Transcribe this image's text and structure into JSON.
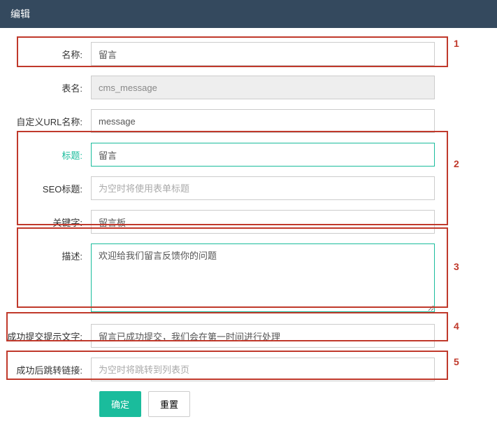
{
  "header": {
    "title": "编辑"
  },
  "form": {
    "name_label": "名称:",
    "name_value": "留言",
    "table_label": "表名:",
    "table_value": "cms_message",
    "url_label": "自定义URL名称:",
    "url_value": "message",
    "title_label": "标题:",
    "title_value": "留言",
    "seo_label": "SEO标题:",
    "seo_value": "",
    "seo_placeholder": "为空时将使用表单标题",
    "keywords_label": "关键字:",
    "keywords_value": "留言板",
    "desc_label": "描述:",
    "desc_value": "欢迎给我们留言反馈你的问题",
    "success_msg_label": "成功提交提示文字:",
    "success_msg_value": "留言已成功提交，我们会在第一时间进行处理",
    "redirect_label": "成功后跳转链接:",
    "redirect_value": "",
    "redirect_placeholder": "为空时将跳转到列表页"
  },
  "buttons": {
    "submit_label": "确定",
    "reset_label": "重置"
  },
  "annotations": {
    "a1": "1",
    "a2": "2",
    "a3": "3",
    "a4": "4",
    "a5": "5"
  }
}
